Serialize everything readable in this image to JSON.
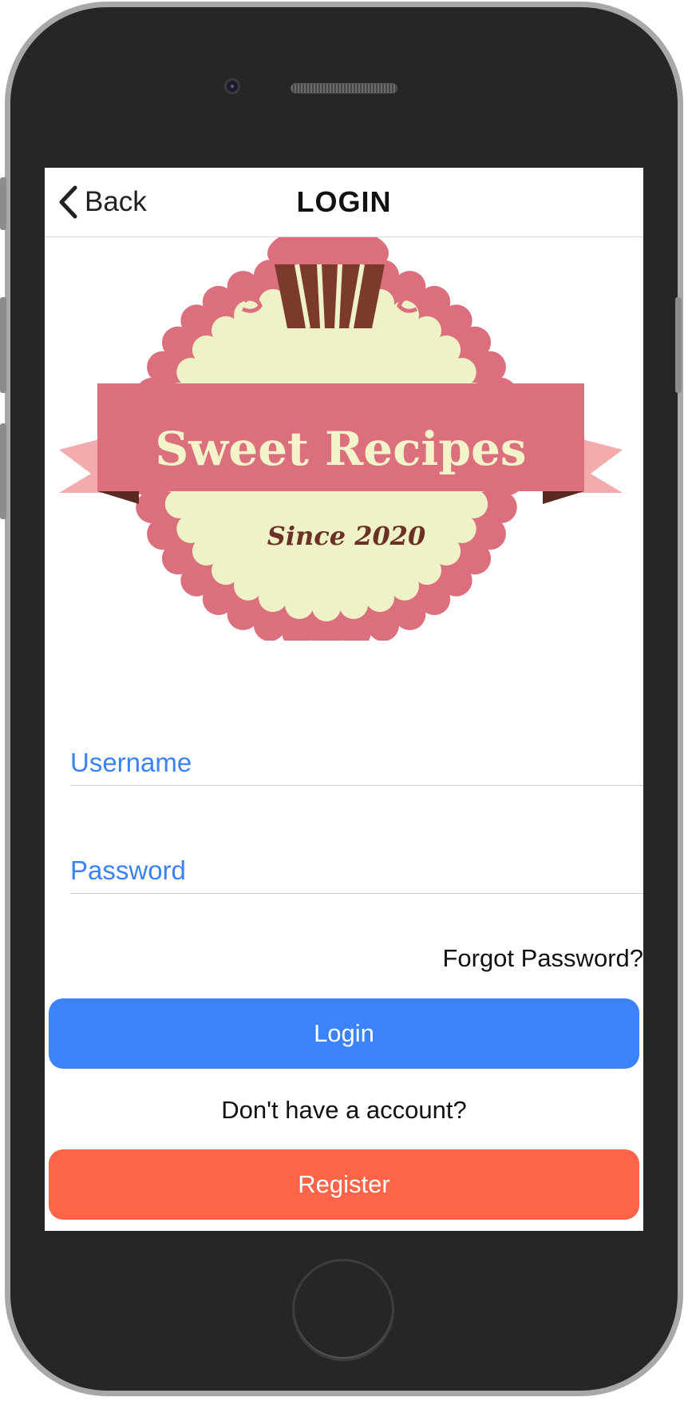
{
  "navbar": {
    "back_label": "Back",
    "title": "LOGIN"
  },
  "logo": {
    "brand_text": "Sweet Recipes",
    "since_text": "Since 2020",
    "colors": {
      "badge": "#db6f7d",
      "inner": "#eef2c6",
      "ribbon_tail": "#f3abae",
      "cupcake": "#7b3a2c"
    }
  },
  "form": {
    "username_placeholder": "Username",
    "username_value": "",
    "password_placeholder": "Password",
    "password_value": "",
    "forgot_label": "Forgot Password?"
  },
  "actions": {
    "login_label": "Login",
    "no_account_text": "Don't have a account?",
    "register_label": "Register"
  },
  "colors": {
    "primary": "#3b82fb",
    "register": "#fe6548",
    "placeholder": "#3b82f6"
  }
}
